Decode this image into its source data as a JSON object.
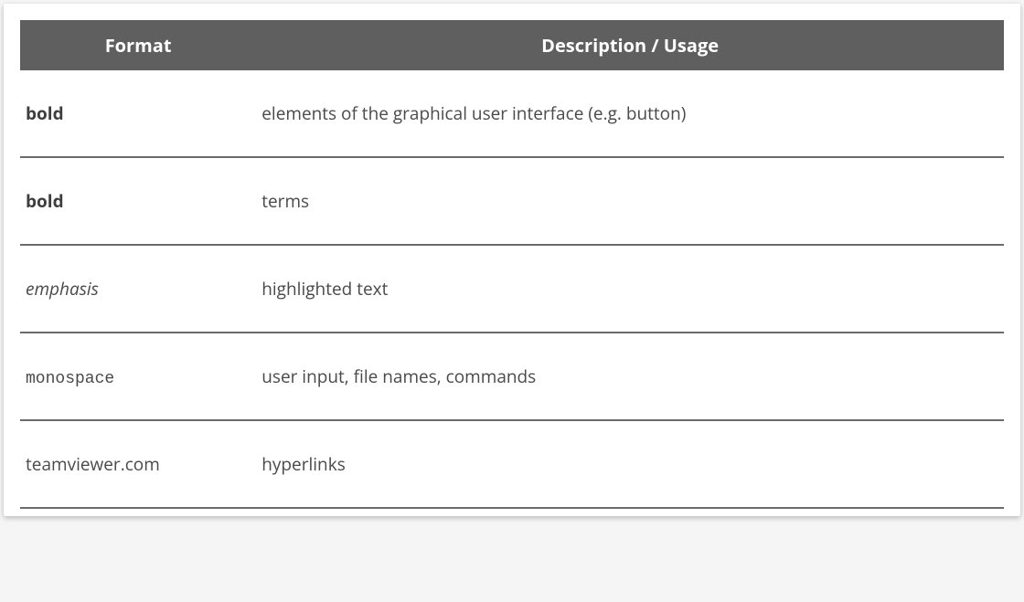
{
  "table": {
    "headers": {
      "format": "Format",
      "description": "Description / Usage"
    },
    "rows": [
      {
        "format": "bold",
        "style": "bold",
        "description": "elements of the graphical user interface (e.g. button)"
      },
      {
        "format": "bold",
        "style": "bold",
        "description": "terms"
      },
      {
        "format": "emphasis",
        "style": "emphasis",
        "description": "highlighted text"
      },
      {
        "format": "monospace",
        "style": "mono",
        "description": "user input, file names, commands"
      },
      {
        "format": "teamviewer.com",
        "style": "link",
        "description": "hyperlinks"
      }
    ]
  }
}
